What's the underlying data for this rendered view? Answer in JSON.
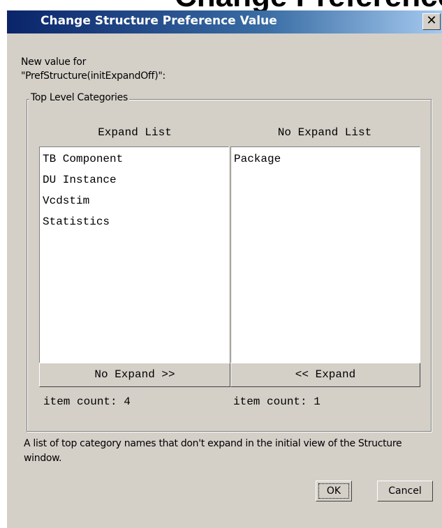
{
  "background_text": "Change Preference Category Properties",
  "dialog": {
    "title": "Change Structure Preference Value",
    "close_glyph": "✕",
    "prompt_line1": "New value for",
    "prompt_line2": "\"PrefStructure(initExpandOff)\":",
    "group_label": "Top Level Categories",
    "expand_list": {
      "header": "Expand List",
      "items": [
        "TB Component",
        "DU Instance",
        "Vcdstim",
        "Statistics"
      ],
      "button_label": "No Expand >>",
      "count_label": "item count: 4"
    },
    "no_expand_list": {
      "header": "No Expand List",
      "items": [
        "Package"
      ],
      "button_label": "<< Expand",
      "count_label": "item count: 1"
    },
    "description": "A list of top category names that don't expand in the initial view of the Structure window.",
    "ok_label": "OK",
    "cancel_label": "Cancel"
  },
  "colors": {
    "dialog_bg": "#d4d0c8",
    "title_gradient_start": "#0a246a",
    "title_gradient_end": "#a6caf0",
    "list_bg": "#ffffff"
  }
}
